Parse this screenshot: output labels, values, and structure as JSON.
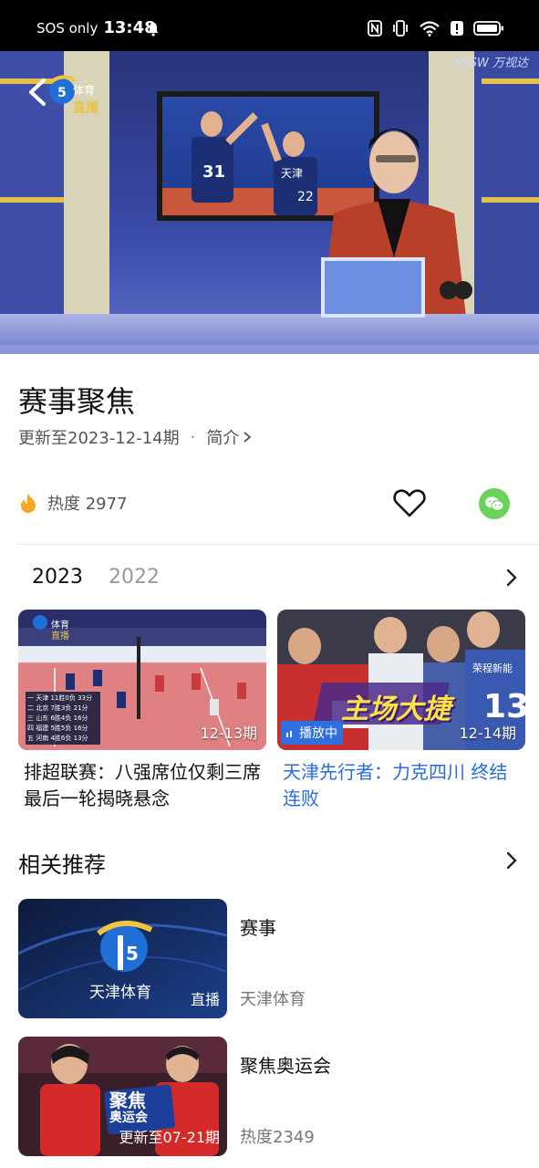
{
  "status_bar": {
    "carrier": "SOS only",
    "time": "13:48"
  },
  "player": {
    "channel_name": "体育",
    "live_label": "直播",
    "broadcaster_text": "WSSW 万视达",
    "jersey_numbers": [
      "31",
      "22"
    ],
    "jersey_team": "天津"
  },
  "show": {
    "title": "赛事聚焦",
    "update_text": "更新至2023-12-14期",
    "separator": "·",
    "intro_label": "简介",
    "heat_label": "热度 2977"
  },
  "year_tabs": [
    {
      "label": "2023",
      "active": true
    },
    {
      "label": "2022",
      "active": false
    }
  ],
  "episodes": [
    {
      "date_badge": "12-13期",
      "title": "排超联赛：八强席位仅剩三席 最后一轮揭晓悬念",
      "playing": false,
      "overlay_logo": "体育",
      "overlay_live": "直播",
      "scoreboard": [
        {
          "rank": "一",
          "team": "天津",
          "record": "11胜0负",
          "points": "33分"
        },
        {
          "rank": "二",
          "team": "北京",
          "record": "7胜3负",
          "points": "21分"
        },
        {
          "rank": "三",
          "team": "山东",
          "record": "6胜4负",
          "points": "16分"
        },
        {
          "rank": "四",
          "team": "福建",
          "record": "5胜5负",
          "points": "16分"
        },
        {
          "rank": "五",
          "team": "河南",
          "record": "4胜6负",
          "points": "13分"
        }
      ]
    },
    {
      "date_badge": "12-14期",
      "playing_label": "播放中",
      "title": "天津先行者：力克四川 终结连败",
      "playing": true,
      "overlay_caption": "主场大捷",
      "jersey_number": "13",
      "jersey_sponsor": "荣程新能"
    }
  ],
  "related": {
    "title": "相关推荐",
    "items": [
      {
        "title": "赛事",
        "subtitle": "天津体育",
        "thumb_label": "直播",
        "thumb_logo_text": "天津体育",
        "thumb_logo_number": "5"
      },
      {
        "title": "聚焦奥运会",
        "subtitle": "热度2349",
        "thumb_label": "更新至07-21期",
        "thumb_caption_line1": "聚焦",
        "thumb_caption_line2": "奥运会"
      }
    ]
  },
  "colors": {
    "accent_blue": "#2a6dd9",
    "wechat_green": "#6cd25a",
    "heat_orange": "#f5a623"
  }
}
